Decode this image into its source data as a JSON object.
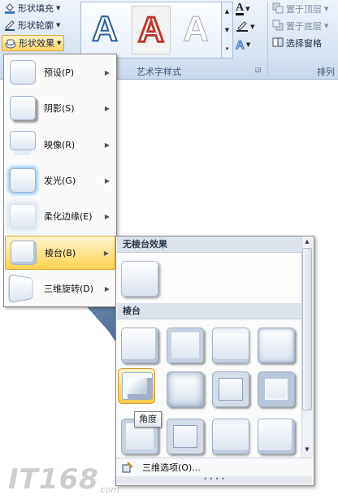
{
  "ribbon": {
    "shape_fill_label": "形状填充",
    "shape_outline_label": "形状轮廓",
    "shape_effects_label": "形状效果",
    "wordart_letter": "A",
    "wordart_group_label": "艺术字样式",
    "arrange_group_label": "排列",
    "bring_to_front_label": "置于顶层",
    "send_to_back_label": "置于底层",
    "selection_pane_label": "选择窗格",
    "text_fill_letter": "A",
    "text_effects_letter": "A"
  },
  "effects_menu": {
    "items": [
      {
        "label": "预设(P)",
        "shortcut": "P"
      },
      {
        "label": "阴影(S)",
        "shortcut": "S"
      },
      {
        "label": "映像(R)",
        "shortcut": "R"
      },
      {
        "label": "发光(G)",
        "shortcut": "G"
      },
      {
        "label": "柔化边缘(E)",
        "shortcut": "E"
      },
      {
        "label": "棱台(B)",
        "shortcut": "B",
        "selected": true
      },
      {
        "label": "三维旋转(D)",
        "shortcut": "D"
      }
    ]
  },
  "bevel_submenu": {
    "no_bevel_header": "无棱台效果",
    "bevel_header": "棱台",
    "hovered_tooltip": "角度",
    "options_label": "三维选项(O)...",
    "grip": "• • • •"
  },
  "watermark": {
    "logo_text": "IT168",
    "domain_text": ".com"
  },
  "colors": {
    "selected_bg": "#ffd24f",
    "wordart_blue": "#2b5f9e",
    "wordart_red": "#c0392b"
  }
}
